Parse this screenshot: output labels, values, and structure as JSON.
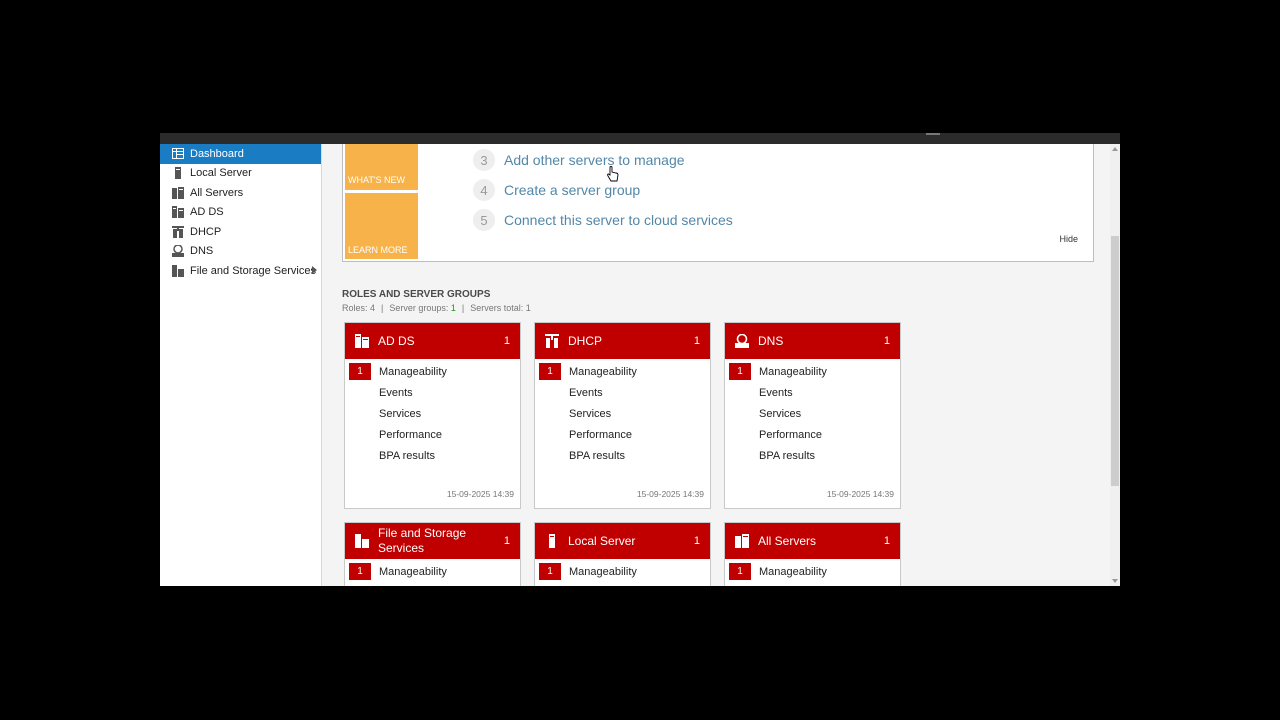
{
  "sidebar": {
    "items": [
      {
        "label": "Dashboard",
        "icon": "dashboard-icon",
        "active": true
      },
      {
        "label": "Local Server",
        "icon": "server-icon"
      },
      {
        "label": "All Servers",
        "icon": "servers-icon"
      },
      {
        "label": "AD DS",
        "icon": "adds-icon"
      },
      {
        "label": "DHCP",
        "icon": "dhcp-icon"
      },
      {
        "label": "DNS",
        "icon": "dns-icon"
      },
      {
        "label": "File and Storage Services",
        "icon": "storage-icon",
        "has_submenu": true
      }
    ]
  },
  "welcome": {
    "whats_new": "WHAT'S NEW",
    "learn_more": "LEARN MORE",
    "steps": [
      {
        "num": "3",
        "label": "Add other servers to manage"
      },
      {
        "num": "4",
        "label": "Create a server group"
      },
      {
        "num": "5",
        "label": "Connect this server to cloud services"
      }
    ],
    "hide": "Hide"
  },
  "roles": {
    "title": "ROLES AND SERVER GROUPS",
    "roles_text": "Roles: 4",
    "groups_label": "Server groups: ",
    "groups_value": "1",
    "servers_text": "Servers total: 1"
  },
  "tiles": [
    {
      "name": "AD DS",
      "count": "1",
      "icon": "adds-icon",
      "rows": [
        "Manageability",
        "Events",
        "Services",
        "Performance",
        "BPA results"
      ],
      "alert": "1",
      "timestamp": "15-09-2025 14:39"
    },
    {
      "name": "DHCP",
      "count": "1",
      "icon": "dhcp-icon",
      "rows": [
        "Manageability",
        "Events",
        "Services",
        "Performance",
        "BPA results"
      ],
      "alert": "1",
      "timestamp": "15-09-2025 14:39"
    },
    {
      "name": "DNS",
      "count": "1",
      "icon": "dns-icon",
      "rows": [
        "Manageability",
        "Events",
        "Services",
        "Performance",
        "BPA results"
      ],
      "alert": "1",
      "timestamp": "15-09-2025 14:39"
    },
    {
      "name": "File and Storage Services",
      "count": "1",
      "icon": "storage-icon",
      "rows": [
        "Manageability"
      ],
      "alert": "1"
    },
    {
      "name": "Local Server",
      "count": "1",
      "icon": "server-icon",
      "rows": [
        "Manageability"
      ],
      "alert": "1"
    },
    {
      "name": "All Servers",
      "count": "1",
      "icon": "servers-icon",
      "rows": [
        "Manageability"
      ],
      "alert": "1"
    }
  ],
  "colors": {
    "accent": "#1a7dc4",
    "tile_red": "#c00000",
    "orange": "#f7b24a"
  }
}
